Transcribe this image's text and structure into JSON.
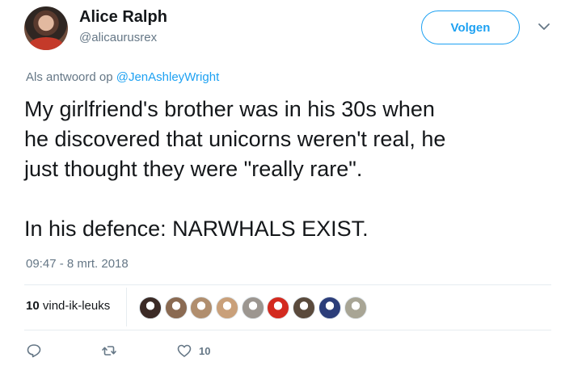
{
  "tweet": {
    "author_name": "Alice Ralph",
    "author_handle": "@alicaurusrex",
    "follow_label": "Volgen",
    "reply_prefix": "Als antwoord op ",
    "reply_mention": "@JenAshleyWright",
    "text": "My girlfriend's brother was in his 30s when\nhe discovered that unicorns weren't real, he\njust thought they were \"really rare\".\n\nIn his defence: NARWHALS EXIST.",
    "timestamp": "09:47 - 8 mrt. 2018",
    "likes_number": "10",
    "likes_label": " vind-ik-leuks",
    "like_count_action": "10"
  },
  "likers": [
    {
      "name": "liker-1",
      "color": "#3b2a25"
    },
    {
      "name": "liker-2",
      "color": "#8a6a52"
    },
    {
      "name": "liker-3",
      "color": "#b08e6e"
    },
    {
      "name": "liker-4",
      "color": "#c9a07a"
    },
    {
      "name": "liker-5",
      "color": "#9c9690"
    },
    {
      "name": "liker-6",
      "color": "#d32a1f"
    },
    {
      "name": "liker-7",
      "color": "#5a4a3c"
    },
    {
      "name": "liker-8",
      "color": "#2c3e7a"
    },
    {
      "name": "liker-9",
      "color": "#a8a595"
    }
  ],
  "colors": {
    "accent": "#1da1f2",
    "secondary_text": "#657786",
    "primary_text": "#14171a"
  },
  "icons": [
    "chevron-down-icon",
    "reply-icon",
    "retweet-icon",
    "heart-icon"
  ]
}
